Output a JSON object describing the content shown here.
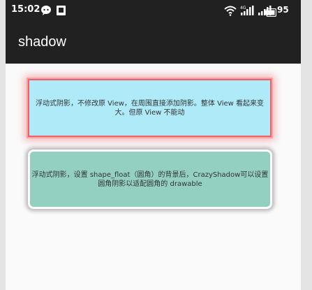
{
  "status_bar": {
    "time": "15:02",
    "battery": "95",
    "icons": [
      "wechat-icon",
      "notification-square-icon",
      "wifi-icon",
      "4g-signal-icon",
      "signal-icon",
      "battery-icon"
    ]
  },
  "app_bar": {
    "title": "shadow"
  },
  "cards": [
    {
      "text": "浮动式阴影，不修改原 View，在周围直接添加阴影。整体 View 看起来变大。但原 View 不能动"
    },
    {
      "text": "浮动式阴影，设置 shape_float（圆角）的背景后，CrazyShadow可以设置圆角阴影以适配圆角的 drawable"
    }
  ],
  "colors": {
    "bar_bg": "#212121",
    "card1_bg": "#aeeaf8",
    "card1_shadow": "#f0606a",
    "card2_bg": "#93d0c2",
    "page_bg": "#fafafa"
  }
}
